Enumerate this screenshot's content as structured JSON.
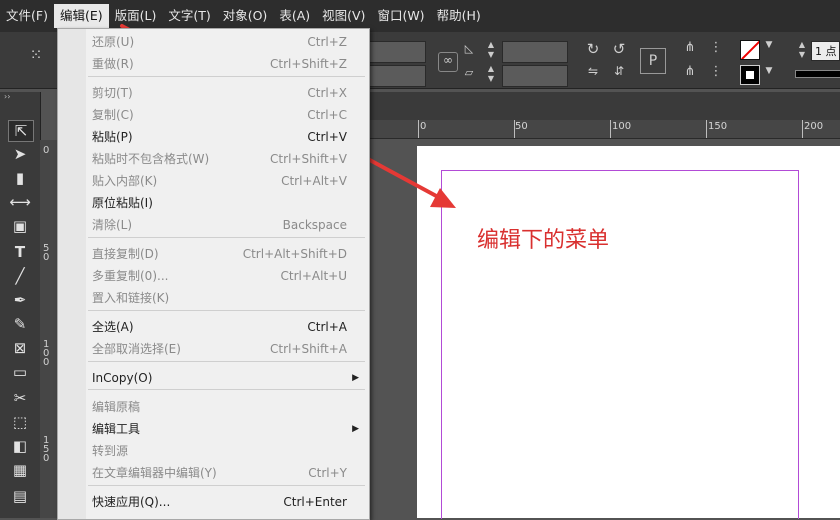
{
  "menubar": {
    "items": [
      "文件(F)",
      "编辑(E)",
      "版面(L)",
      "文字(T)",
      "对象(O)",
      "表(A)",
      "视图(V)",
      "窗口(W)",
      "帮助(H)"
    ]
  },
  "control_bar": {
    "stroke_label": "1 点"
  },
  "ruler": {
    "h_labels": [
      "0",
      "50",
      "100",
      "150",
      "200"
    ],
    "v_labels": [
      "0",
      "5\n0",
      "1\n0\n0",
      "1\n5\n0"
    ]
  },
  "edit_menu": {
    "items": [
      {
        "label": "还原(U)",
        "shortcut": "Ctrl+Z",
        "disabled": true
      },
      {
        "label": "重做(R)",
        "shortcut": "Ctrl+Shift+Z",
        "disabled": true
      },
      {
        "label": "剪切(T)",
        "shortcut": "Ctrl+X",
        "disabled": true
      },
      {
        "label": "复制(C)",
        "shortcut": "Ctrl+C",
        "disabled": true
      },
      {
        "label": "粘贴(P)",
        "shortcut": "Ctrl+V",
        "disabled": false
      },
      {
        "label": "粘贴时不包含格式(W)",
        "shortcut": "Ctrl+Shift+V",
        "disabled": true
      },
      {
        "label": "贴入内部(K)",
        "shortcut": "Ctrl+Alt+V",
        "disabled": true
      },
      {
        "label": "原位粘贴(I)",
        "shortcut": "",
        "disabled": false
      },
      {
        "label": "清除(L)",
        "shortcut": "Backspace",
        "disabled": true
      },
      {
        "label": "直接复制(D)",
        "shortcut": "Ctrl+Alt+Shift+D",
        "disabled": true
      },
      {
        "label": "多重复制(0)...",
        "shortcut": "Ctrl+Alt+U",
        "disabled": true
      },
      {
        "label": "置入和链接(K)",
        "shortcut": "",
        "disabled": true
      },
      {
        "label": "全选(A)",
        "shortcut": "Ctrl+A",
        "disabled": false
      },
      {
        "label": "全部取消选择(E)",
        "shortcut": "Ctrl+Shift+A",
        "disabled": true
      },
      {
        "label": "InCopy(O)",
        "shortcut": "",
        "disabled": false,
        "submenu": true
      },
      {
        "label": "编辑原稿",
        "shortcut": "",
        "disabled": true
      },
      {
        "label": "编辑工具",
        "shortcut": "",
        "disabled": false,
        "submenu": true
      },
      {
        "label": "转到源",
        "shortcut": "",
        "disabled": true
      },
      {
        "label": "在文章编辑器中编辑(Y)",
        "shortcut": "Ctrl+Y",
        "disabled": true
      },
      {
        "label": "快速应用(Q)...",
        "shortcut": "Ctrl+Enter",
        "disabled": false
      }
    ]
  },
  "annotation": {
    "text": "编辑下的菜单",
    "color": "#d9302f"
  },
  "colors": {
    "accent_arrow": "#e53935",
    "margin_guide": "#b24bd6"
  },
  "icons": [
    "select-tool-icon",
    "direct-select-tool-icon",
    "page-tool-icon",
    "gap-tool-icon",
    "content-collector-icon",
    "type-tool-icon",
    "line-tool-icon",
    "pen-tool-icon",
    "pencil-tool-icon",
    "rectangle-frame-tool-icon",
    "rectangle-tool-icon",
    "scissors-tool-icon",
    "free-transform-tool-icon",
    "gradient-swatch-tool-icon",
    "gradient-feather-tool-icon",
    "note-tool-icon"
  ]
}
